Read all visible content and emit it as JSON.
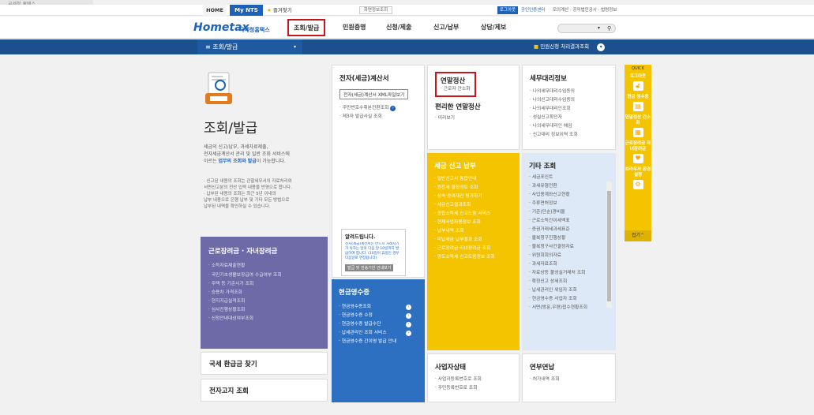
{
  "browser": {
    "tab_title": "국세청 홈택스"
  },
  "topbar": {
    "home": "HOME",
    "mynts": "My NTS",
    "fav": "즐겨찾기",
    "search_mini": "화면정보조회",
    "login": "로그아웃",
    "cert": "공인인증센터",
    "links": "모의계산 · 공익법인공시 · 법령정보"
  },
  "nav": {
    "logo_main": "Hometax",
    "logo_sub": "국세청홈택스",
    "items": [
      "조회/발급",
      "민원증명",
      "신청/제출",
      "신고/납부",
      "상담/제보"
    ],
    "search_placeholder": ""
  },
  "subbar": {
    "current": "조회/발급",
    "right_text": "민원신청 처리결과조회"
  },
  "hero": {
    "title": "조회/발급",
    "desc_1": "세금의 신고/납부, 과세자료제출,",
    "desc_2": "전자세금계산서 관리 및 일반 조회 서비스에",
    "desc_3": "이르는",
    "desc_bold": "업무의 조회와 발급",
    "desc_4": "이 가능합니다.",
    "note_1": "· 신고된 내용의 조회는 관할세무서의 자료처리와",
    "note_2": "  서면신고분의 전산 입력 내용을 반영으로 합니다.",
    "note_3": "· 납부된 내용의 조회는 최근 5년 이내의",
    "note_4": "  납부 내용으로 은행 납부 및 기타 모든 방법으로",
    "note_5": "  납부된 내역을 확인하실 수 있습니다."
  },
  "panels": {
    "einvoice": {
      "title": "전자(세금)계산서",
      "button": "전자(세금)계산서 XML파일보기",
      "items": [
        "주민번호수취분전환조회",
        "제3자 발급사실 조회"
      ]
    },
    "notice": {
      "title": "알려드립니다.",
      "text": "전자(세금)계산서는 반드시 거래시기가 속하는 달의 다음 달 10일까지 발급하여 합니다. (10일이 휴일인 경우 다음날로 연장됩니다)",
      "button": "발급 및 전송기한 안내보기"
    },
    "yearend": {
      "title": "연말정산",
      "items": [
        "근로자 간소화"
      ]
    },
    "easy_yearend": {
      "title": "편리한 연말정산",
      "items": [
        "미리보기"
      ]
    },
    "tax_agent": {
      "title": "세무대리정보",
      "items": [
        "나의세무대리수임동의",
        "나의신고대리수임동의",
        "나의세무대리인조회",
        "성실신고확인자",
        "나의세무대리인 해임",
        "신고대리 정보이력 조회"
      ]
    },
    "filing": {
      "title": "세금 신고 납부",
      "items": [
        "일반신고서 통합안내",
        "원천세 결정정보 조회",
        "상속·증여재산 평가하기",
        "세금신고결과조회",
        "종합소득세 신고도움 서비스",
        "현재사업자용정보 조회",
        "납부내역 조회",
        "미납세금 납부결과 조회",
        "근로장려금·자녀장려금 조회",
        "양도소득세 신고도움정보 조회"
      ]
    },
    "other": {
      "title": "기타 조회",
      "items": [
        "세금포인트",
        "과세유형전환",
        "사업용계좌신고현황",
        "주류면허정보",
        "기준(단순)경비율",
        "근로소득간이세액표",
        "증권거래세과세표준",
        "불복청구진행상황",
        "불복청구사건결정자료",
        "위원회회의자료",
        "과세자료조회",
        "자료상등 불성실거래처 조회",
        "확정신고 상세조회",
        "납세관리인 위임자 조회",
        "현금영수증 사업자 조회",
        "서면(방문,우편)접수현황조회"
      ]
    },
    "labor": {
      "title": "근로장려금 · 자녀장려금",
      "items": [
        "소득자료제출현황",
        "국민기초생활보장급여 수급여부 조회",
        "주택 등 기준시가 조회",
        "승용차 가격조회",
        "현지지급실적조회",
        "심사진행상황조회",
        "신청안내대상여부조회"
      ]
    },
    "cashreceipt": {
      "title": "현금영수증",
      "items": [
        "현금영수증조회",
        "현금영수증 수정",
        "현금영수증 발급수단",
        "납세관리인 조회 서비스",
        "현금영수증 간이영 발급 안내"
      ]
    },
    "refund": {
      "title": "국세 환급금 찾기"
    },
    "ebill": {
      "title": "전자고지 조회"
    },
    "bizstatus": {
      "title": "사업자상태",
      "items": [
        "사업자등록번호로 조회",
        "주민등록번호로 조회"
      ]
    },
    "pension": {
      "title": "연부연납",
      "items": [
        "허가내역 조회"
      ]
    }
  },
  "quick": {
    "title": "QUICK",
    "items": [
      "로그아웃",
      "현금 영수증",
      "연말정산 간소화",
      "근로장려금 자녀장려금",
      "브라우저 환경설정"
    ],
    "close": "접기"
  },
  "colors": {
    "brand": "#1d62b8",
    "nav_dark": "#1c4f8e",
    "purple": "#6e6aa7",
    "blue": "#2d6fc1",
    "yellow": "#f5c400",
    "lightblue": "#dde9f6",
    "highlight": "#c4161c"
  }
}
